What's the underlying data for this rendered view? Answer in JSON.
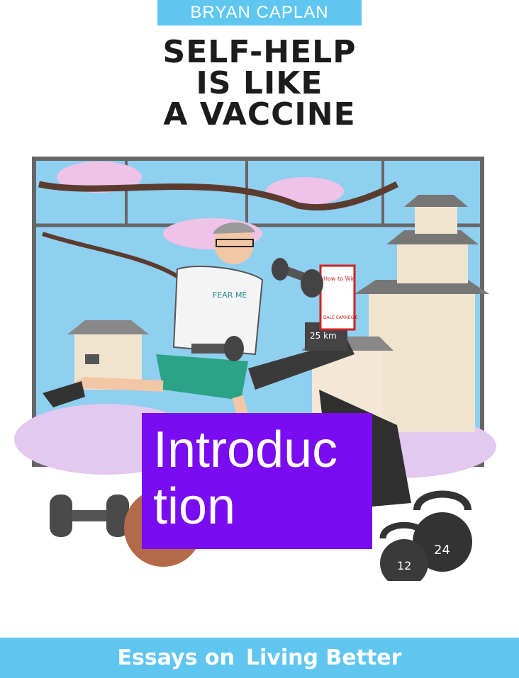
{
  "cover": {
    "author": "BRYAN CAPLAN",
    "title_lines": [
      "SELF-HELP",
      "IS LIKE",
      "A VACCINE"
    ],
    "overlay_label": [
      "Introduc",
      "tion"
    ],
    "subtitle_left": "Essays on",
    "subtitle_right": "Living Better",
    "book_sign_text": "How to Win Friends and Influence People",
    "book_sign_author": "DALE CARNEGIE",
    "treadmill_speed": "25 km",
    "kettlebell_left": "12",
    "kettlebell_right": "24",
    "shirt_text": "FEAR ME",
    "colors": {
      "accent_blue": "#5fc6f0",
      "overlay_purple": "#7a0cf2",
      "title_black": "#1c1c1c"
    }
  }
}
